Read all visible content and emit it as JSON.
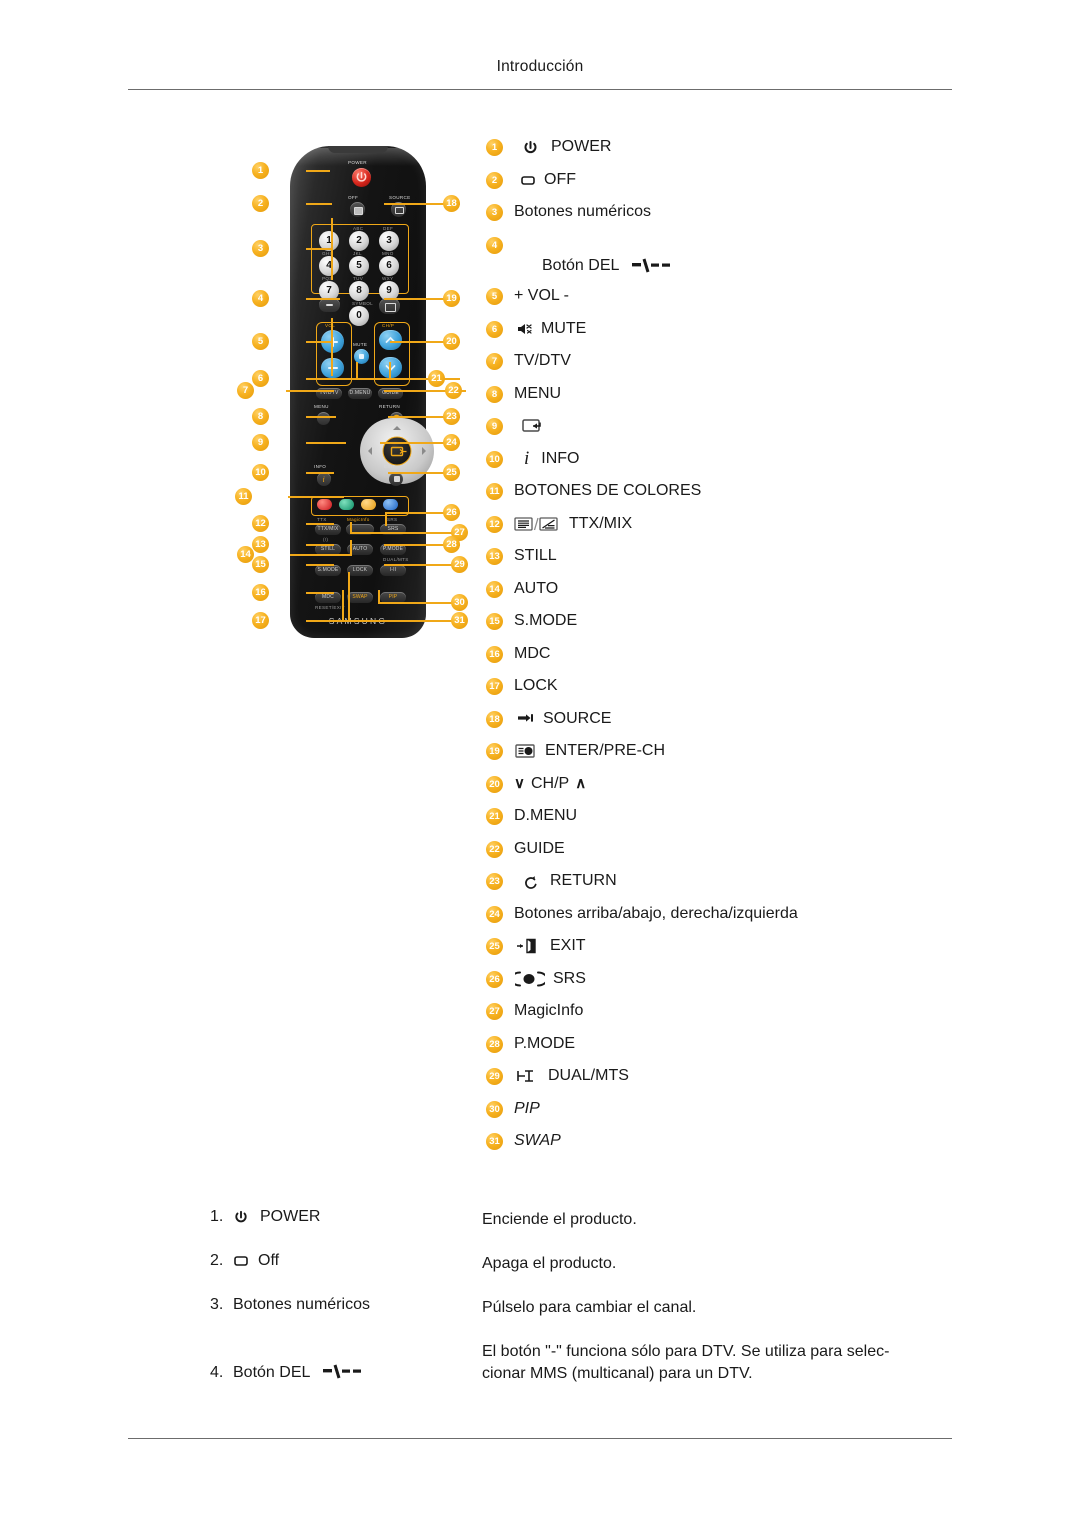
{
  "header": {
    "title": "Introducción"
  },
  "remote": {
    "brand": "SAMSUNG",
    "keys": {
      "power_label": "POWER",
      "off_label": "OFF",
      "source_label": "SOURCE",
      "vol_label": "VOL",
      "mute_label": "MUTE",
      "chp_label": "CH/P",
      "tvdtv_label": "TV/DTV",
      "dmenu_label": "D.MENU",
      "guide_label": "GUIDE",
      "menu_label": "MENU",
      "return_label": "RETURN",
      "info_label": "INFO",
      "exit_label": "EXIT",
      "ttxmix_label": "TTX/MIX",
      "magicinfo_label": "MagicInfo",
      "srs_label": "SRS",
      "still_label": "STILL",
      "auto_label": "AUTO",
      "pmode_label": "P.MODE",
      "smode_label": "S.MODE",
      "lock_label": "LOCK",
      "dualmts_label": "DUAL/MTS",
      "mdc_label": "MDC",
      "swap_label": "SWAP",
      "pip_label": "PIP",
      "digits": [
        "1",
        "2",
        "3",
        "4",
        "5",
        "6",
        "7",
        "8",
        "9",
        "0"
      ],
      "digit_subs": [
        "",
        "ABC",
        "DEF",
        "GHI",
        "JKL",
        "MNO",
        "PQS",
        "TUV",
        "WXY",
        "SYMBOL"
      ],
      "del_key": "-/--"
    }
  },
  "legend": {
    "items": [
      {
        "num": "1",
        "icon": "power-icon",
        "label": "POWER"
      },
      {
        "num": "2",
        "icon": "off-icon",
        "label": "OFF"
      },
      {
        "num": "3",
        "icon": "",
        "label": "Botones numéricos"
      },
      {
        "num": "4",
        "icon": "del-dash-icon",
        "label": "Botón DEL"
      },
      {
        "num": "5",
        "icon": "",
        "label": "+ VOL -"
      },
      {
        "num": "6",
        "icon": "mute-icon",
        "label": "MUTE"
      },
      {
        "num": "7",
        "icon": "",
        "label": "TV/DTV"
      },
      {
        "num": "8",
        "icon": "",
        "label": "MENU"
      },
      {
        "num": "9",
        "icon": "enter-box-icon",
        "label": ""
      },
      {
        "num": "10",
        "icon": "info-i-icon",
        "label": "INFO"
      },
      {
        "num": "11",
        "icon": "",
        "label": "BOTONES DE COLORES"
      },
      {
        "num": "12",
        "icon": "ttx-mix-icon",
        "label": "TTX/MIX"
      },
      {
        "num": "13",
        "icon": "",
        "label": "STILL"
      },
      {
        "num": "14",
        "icon": "",
        "label": "AUTO"
      },
      {
        "num": "15",
        "icon": "",
        "label": "S.MODE"
      },
      {
        "num": "16",
        "icon": "",
        "label": "MDC"
      },
      {
        "num": "17",
        "icon": "",
        "label": "LOCK"
      },
      {
        "num": "18",
        "icon": "source-icon",
        "label": "SOURCE"
      },
      {
        "num": "19",
        "icon": "enter-prech-icon",
        "label": "ENTER/PRE-CH"
      },
      {
        "num": "20",
        "icon": "chp-arrows-icon",
        "label": "CH/P"
      },
      {
        "num": "21",
        "icon": "",
        "label": "D.MENU"
      },
      {
        "num": "22",
        "icon": "",
        "label": "GUIDE"
      },
      {
        "num": "23",
        "icon": "return-arrow-icon",
        "label": "RETURN"
      },
      {
        "num": "24",
        "icon": "",
        "label": "Botones arriba/abajo, derecha/izquierda"
      },
      {
        "num": "25",
        "icon": "exit-door-icon",
        "label": "EXIT"
      },
      {
        "num": "26",
        "icon": "srs-icon",
        "label": "SRS"
      },
      {
        "num": "27",
        "icon": "",
        "label": "MagicInfo"
      },
      {
        "num": "28",
        "icon": "",
        "label": "P.MODE"
      },
      {
        "num": "29",
        "icon": "dual-mts-icon",
        "label": "DUAL/MTS"
      },
      {
        "num": "30",
        "icon": "",
        "label": "PIP"
      },
      {
        "num": "31",
        "icon": "",
        "label": "SWAP"
      }
    ],
    "chp_down": "∨",
    "chp_up": "∧"
  },
  "descriptions": [
    {
      "index": "1.",
      "icon": "power-icon",
      "term": "POWER",
      "definition": "Enciende el producto."
    },
    {
      "index": "2.",
      "icon": "off-icon",
      "term": "Off",
      "definition": "Apaga el producto."
    },
    {
      "index": "3.",
      "icon": "",
      "term": "Botones numéricos",
      "definition": "Púlselo para cambiar el canal."
    },
    {
      "index": "4.",
      "icon": "del-dash-icon",
      "term": "Botón DEL",
      "definition": "El botón \"-\" funciona sólo para DTV. Se utiliza para seleccionar MMS (multicanal) para un DTV.",
      "definition_line1": "El botón \"-\" funciona sólo para DTV. Se utiliza para selec-",
      "definition_line2": "cionar MMS (multicanal) para un DTV."
    }
  ],
  "colors": {
    "badge": "#f7b221",
    "rule": "#6c6c6c",
    "text": "#1a1a1a",
    "remote_body": "#101010"
  }
}
